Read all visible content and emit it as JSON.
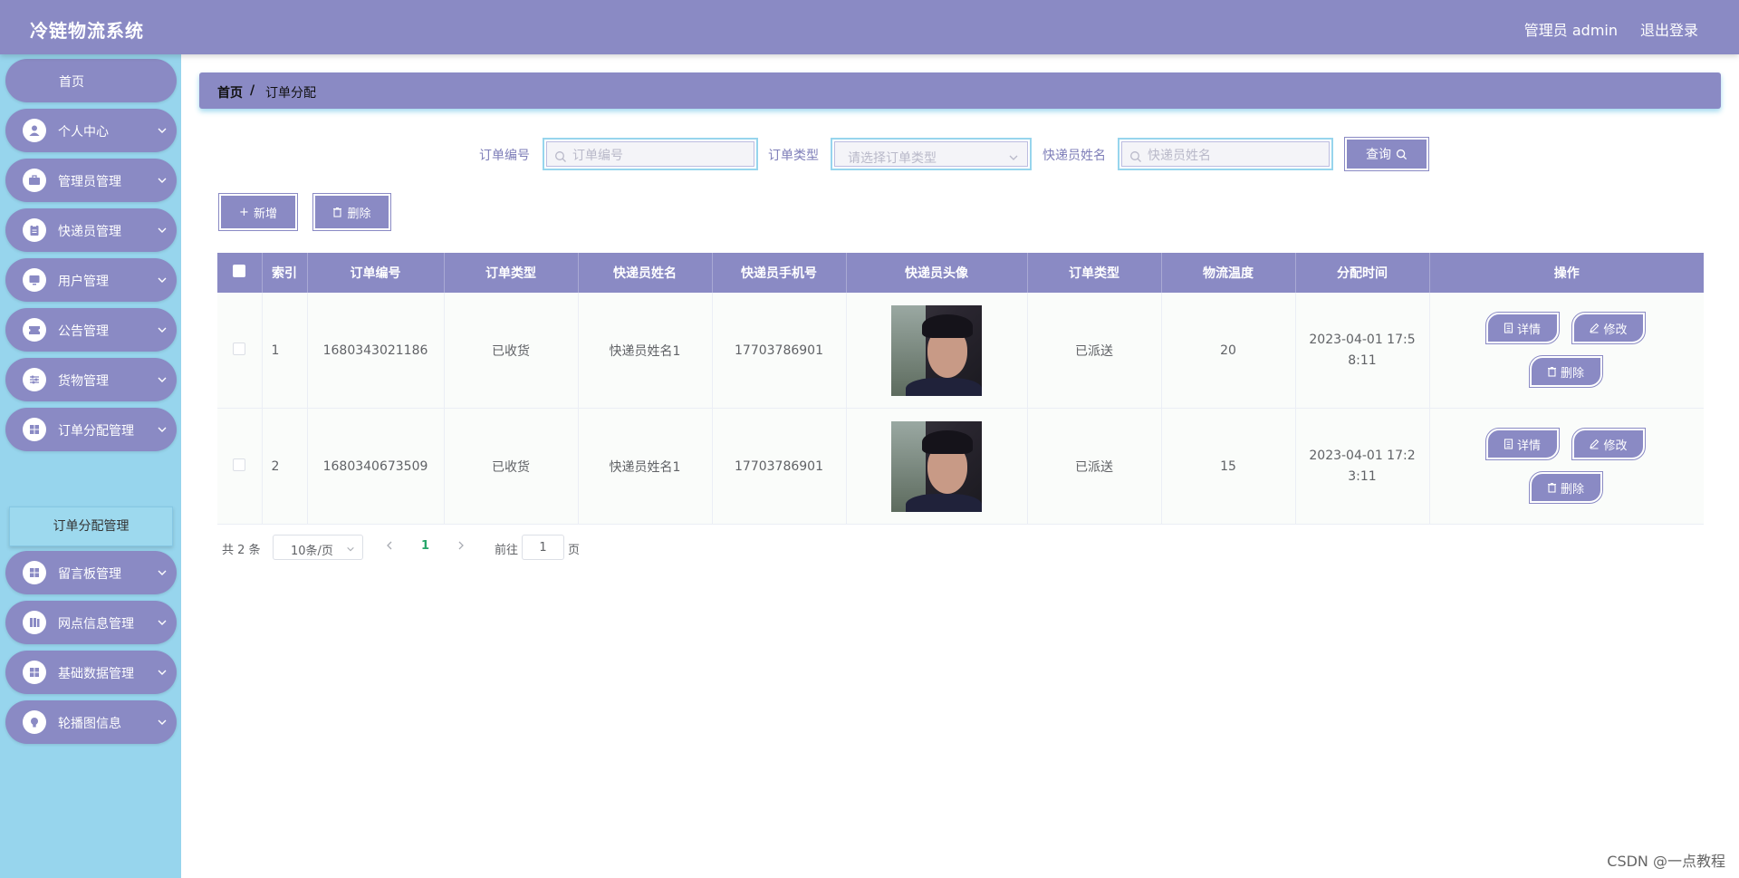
{
  "header": {
    "app_title": "冷链物流系统",
    "admin_label": "管理员 admin",
    "logout_label": "退出登录"
  },
  "sidebar": {
    "items": [
      {
        "label": "首页",
        "icon": "home"
      },
      {
        "label": "个人中心",
        "icon": "user-icon"
      },
      {
        "label": "管理员管理",
        "icon": "briefcase-icon"
      },
      {
        "label": "快递员管理",
        "icon": "clipboard-icon"
      },
      {
        "label": "用户管理",
        "icon": "monitor-icon"
      },
      {
        "label": "公告管理",
        "icon": "ticket-icon"
      },
      {
        "label": "货物管理",
        "icon": "sliders-icon"
      },
      {
        "label": "订单分配管理",
        "icon": "grid-icon"
      },
      {
        "label": "留言板管理",
        "icon": "grid-icon"
      },
      {
        "label": "网点信息管理",
        "icon": "book-icon"
      },
      {
        "label": "基础数据管理",
        "icon": "grid-icon"
      },
      {
        "label": "轮播图信息",
        "icon": "bulb-icon"
      }
    ],
    "subitem": "订单分配管理"
  },
  "breadcrumb": {
    "home": "首页",
    "separator": "/",
    "current": "订单分配"
  },
  "search": {
    "order_no_label": "订单编号",
    "order_no_placeholder": "订单编号",
    "order_type_label": "订单类型",
    "order_type_placeholder": "请选择订单类型",
    "courier_label": "快递员姓名",
    "courier_placeholder": "快递员姓名",
    "query_label": "查询"
  },
  "actions": {
    "add_label": "新增",
    "delete_label": "删除"
  },
  "table": {
    "columns": [
      "索引",
      "订单编号",
      "订单类型",
      "快递员姓名",
      "快递员手机号",
      "快递员头像",
      "订单类型",
      "物流温度",
      "分配时间",
      "操作"
    ],
    "rows": [
      {
        "index": "1",
        "order_no": "1680343021186",
        "order_type": "已收货",
        "courier_name": "快递员姓名1",
        "courier_phone": "17703786901",
        "status": "已派送",
        "temperature": "20",
        "time": "2023-04-01 17:58:11"
      },
      {
        "index": "2",
        "order_no": "1680340673509",
        "order_type": "已收货",
        "courier_name": "快递员姓名1",
        "courier_phone": "17703786901",
        "status": "已派送",
        "temperature": "15",
        "time": "2023-04-01 17:23:11"
      }
    ],
    "op_detail": "详情",
    "op_edit": "修改",
    "op_delete": "删除"
  },
  "pagination": {
    "total": "共 2 条",
    "page_size": "10条/页",
    "current": "1",
    "goto_label": "前往",
    "goto_value": "1",
    "page_suffix": "页"
  },
  "watermark": "CSDN @一点教程",
  "colors": {
    "primary": "#8a8ac4",
    "sidebar_bg": "#97d5ed",
    "active_page": "#27a56a"
  }
}
